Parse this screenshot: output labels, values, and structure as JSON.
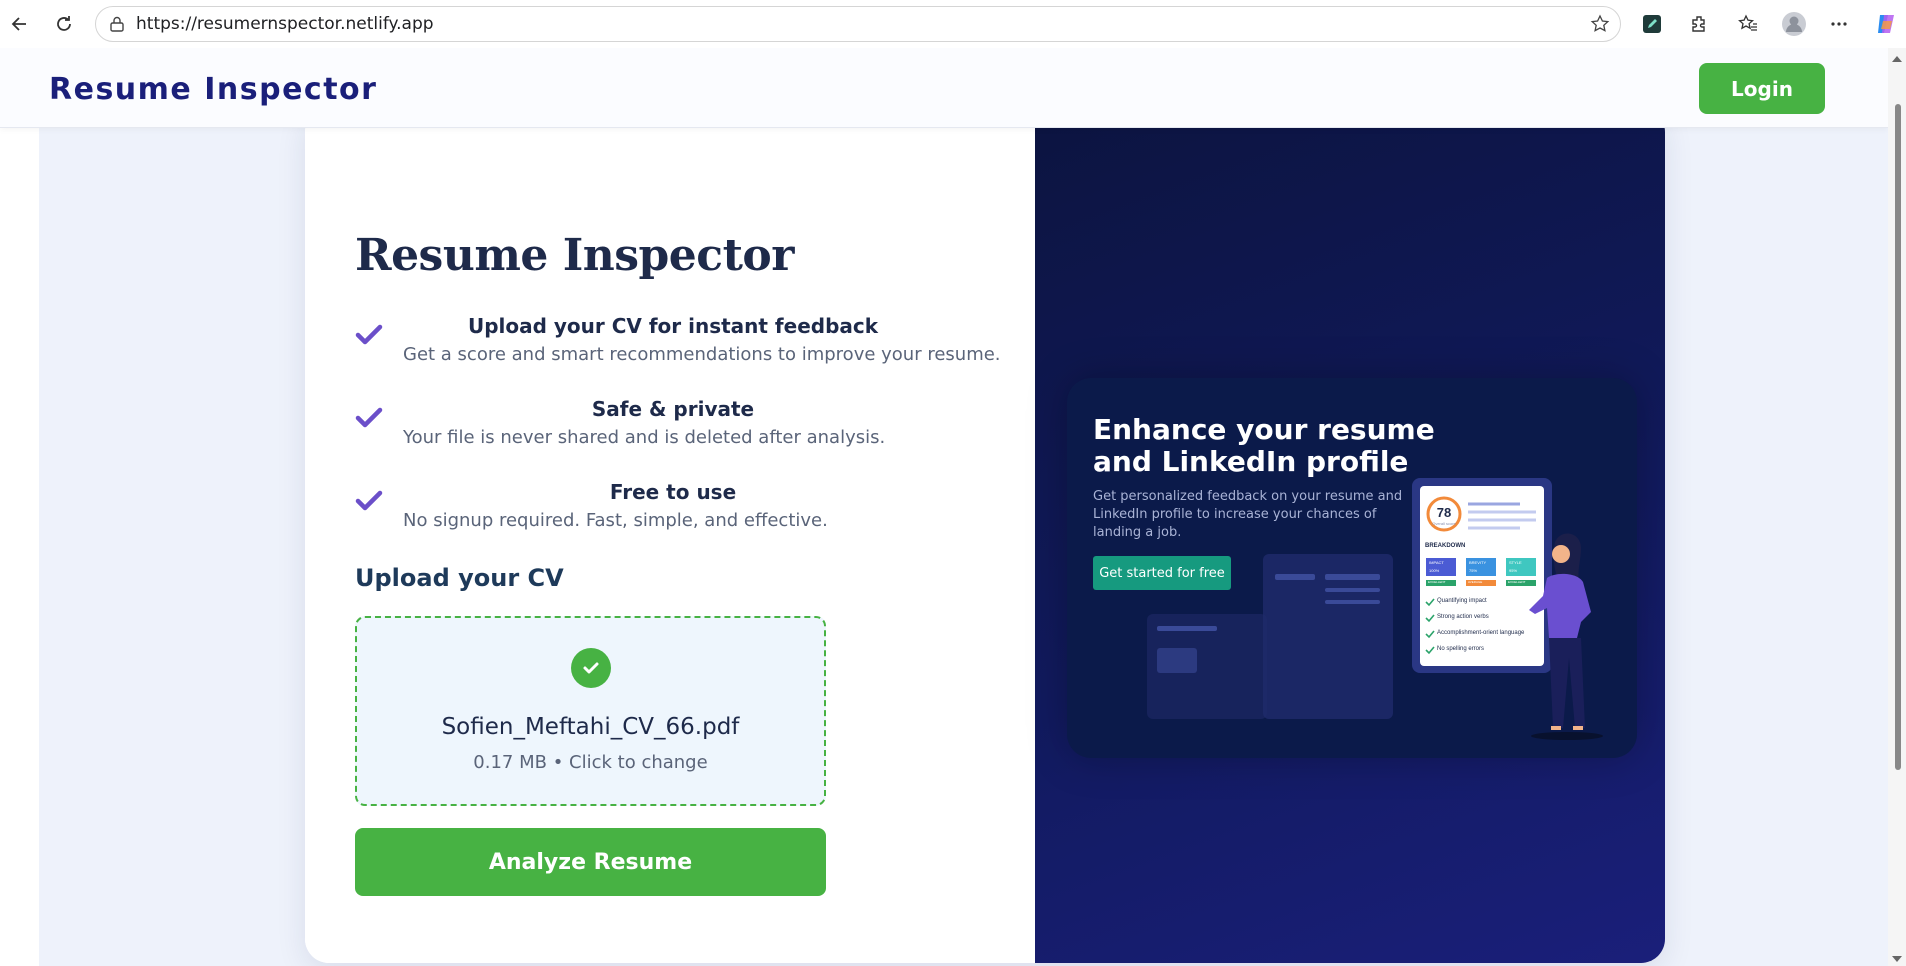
{
  "browser": {
    "url": "https://resumernspector.netlify.app",
    "icons": [
      "back-icon",
      "reload-icon",
      "lock-icon",
      "star-icon",
      "pen-icon",
      "extensions-icon",
      "favorites-icon",
      "profile-icon",
      "more-icon",
      "copilot-icon"
    ]
  },
  "header": {
    "brand": "Resume Inspector",
    "login_label": "Login"
  },
  "main": {
    "title": "Resume Inspector",
    "features": [
      {
        "title": "Upload your CV for instant feedback",
        "desc": "Get a score and smart recommendations to improve your resume."
      },
      {
        "title": "Safe & private",
        "desc": "Your file is never shared and is deleted after analysis."
      },
      {
        "title": "Free to use",
        "desc": "No signup required. Fast, simple, and effective."
      }
    ],
    "upload_title": "Upload your CV",
    "file_name": "Sofien_Meftahi_CV_66.pdf",
    "file_meta": "0.17 MB • Click to change",
    "analyze_label": "Analyze Resume"
  },
  "promo": {
    "title": "Enhance your resume and LinkedIn profile",
    "desc": "Get personalized feedback on your resume and LinkedIn profile to increase your chances of landing a job.",
    "cta": "Get started for free",
    "score": "78",
    "score_caption": "Overall score",
    "breakdown_label": "BREAKDOWN",
    "tiles": [
      {
        "label": "IMPACT",
        "value": "100%",
        "tag": "EXCELLENT"
      },
      {
        "label": "BREVITY",
        "value": "75%",
        "tag": "AVERAGE"
      },
      {
        "label": "STYLE",
        "value": "95%",
        "tag": "EXCELLENT"
      }
    ],
    "checklist": [
      "Quantifying impact",
      "Strong action verbs",
      "Accomplishment-orient language",
      "No spelling errors"
    ]
  },
  "colors": {
    "brand": "#1a1f7a",
    "accent_green": "#47b243",
    "promo_bg": "#0b1a4a",
    "cta_teal": "#169a7f"
  }
}
